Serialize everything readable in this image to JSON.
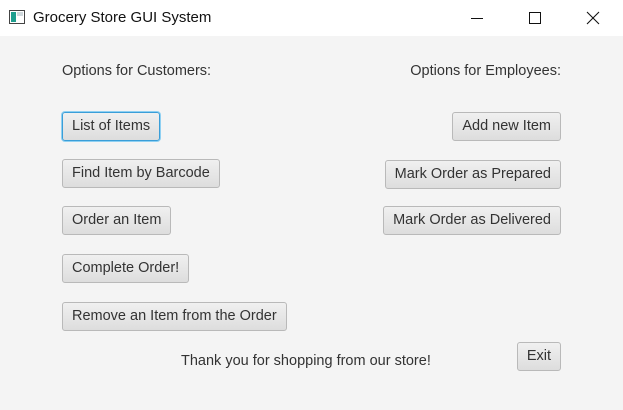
{
  "window": {
    "title": "Grocery Store GUI System",
    "controls": {
      "minimize_icon": "minimize-icon",
      "maximize_icon": "maximize-icon",
      "close_icon": "close-icon"
    }
  },
  "customers": {
    "heading": "Options for Customers:",
    "buttons": [
      "List of Items",
      "Find Item by Barcode",
      "Order an Item",
      "Complete Order!",
      "Remove an Item from the Order"
    ]
  },
  "employees": {
    "heading": "Options for Employees:",
    "buttons": [
      "Add new Item",
      "Mark Order as Prepared",
      "Mark Order as Delivered"
    ]
  },
  "footer": {
    "message": "Thank you for shopping from our store!",
    "exit_label": "Exit"
  },
  "colors": {
    "background": "#f4f4f4",
    "focus_ring": "#3a9ed8",
    "button_border": "#b9b9b9"
  }
}
